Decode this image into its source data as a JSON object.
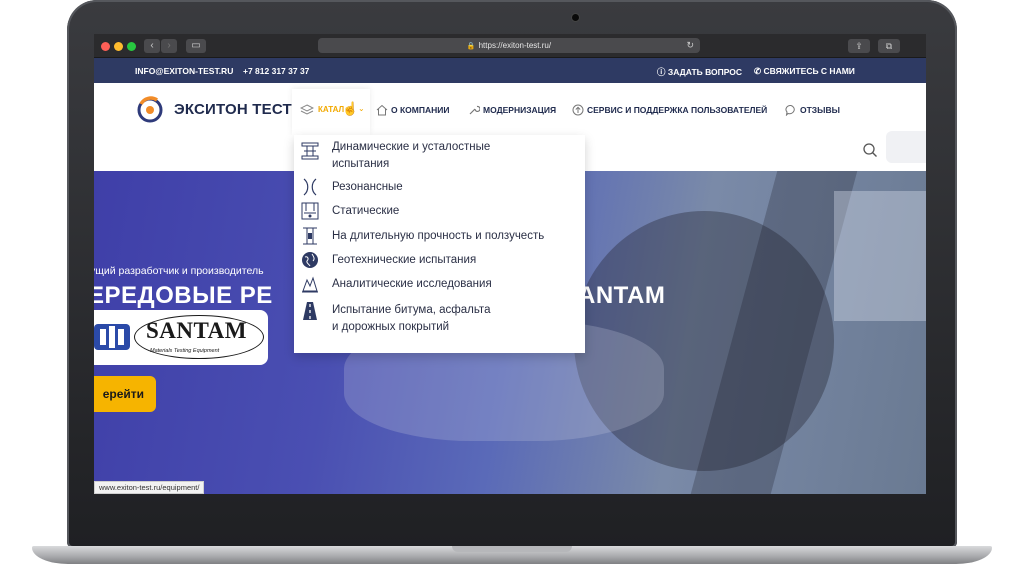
{
  "browser": {
    "url": "https://exiton-test.ru/",
    "status_url": "www.exiton-test.ru/equipment/"
  },
  "topbar": {
    "email": "INFO@EXITON-TEST.RU",
    "phone": "+7 812 317 37 37",
    "ask_question": "ЗАДАТЬ ВОПРОС",
    "contact_us": "СВЯЖИТЕСЬ С НАМИ"
  },
  "header": {
    "logo_text": "ЭКСИТОН ТЕСТ",
    "nav": {
      "catalog": "КАТАЛ",
      "about": "О КОМПАНИИ",
      "modernization": "МОДЕРНИЗАЦИЯ",
      "service": "СЕРВИС И ПОДДЕРЖКА ПОЛЬЗОВАТЕЛЕЙ",
      "reviews": "ОТЗЫВЫ"
    }
  },
  "dropdown": {
    "items": [
      {
        "label": "Динамические и усталостные\nиспытания",
        "icon": "dynamic-test-icon"
      },
      {
        "label": "Резонансные",
        "icon": "resonance-icon"
      },
      {
        "label": "Статические",
        "icon": "static-test-icon"
      },
      {
        "label": "На длительную прочность и ползучесть",
        "icon": "creep-test-icon"
      },
      {
        "label": "Геотехнические испытания",
        "icon": "globe-icon"
      },
      {
        "label": "Аналитические исследования",
        "icon": "analytics-icon"
      },
      {
        "label": "Испытание битума, асфальта\nи дорожных покрытий",
        "icon": "road-icon"
      }
    ]
  },
  "hero": {
    "subtitle": "ущий разработчик и производитель",
    "title_left": "ЕРЕДОВЫЕ РЕ",
    "title_right": "ANTAM",
    "brand_name": "SANTAM",
    "brand_tagline": "Materials Testing Equipment",
    "button_label": "ерейти"
  },
  "colors": {
    "topbar": "#2e3a63",
    "accent": "#f6b400",
    "nav_text": "#1f2a4d"
  }
}
